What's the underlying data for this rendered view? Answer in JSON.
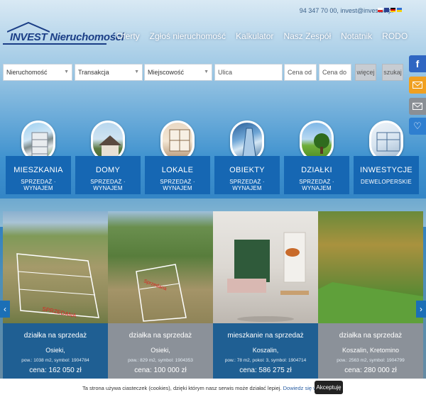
{
  "header": {
    "contact": "94 347 70 00, invest@investsc.pl",
    "logo_text": "INVEST Nieruchomości",
    "nav": [
      "Oferty",
      "Zgłoś nieruchomość",
      "Kalkulator",
      "Nasz Zespół",
      "Notatnik",
      "RODO"
    ]
  },
  "social": [
    {
      "icon": "facebook-icon",
      "color": "#2f66c2"
    },
    {
      "icon": "mail-icon",
      "color": "#f0a020"
    },
    {
      "icon": "envelope-icon",
      "color": "#8a8f95"
    },
    {
      "icon": "heart-icon",
      "color": "#2f7fd0"
    }
  ],
  "search": {
    "property": "Nieruchomość",
    "transaction": "Transakcja",
    "city": "Miejscowość",
    "street": "Ulica",
    "price_from": "Cena od",
    "price_to": "Cena do",
    "more": "więcej",
    "submit": "szukaj"
  },
  "categories": [
    {
      "title": "MIESZKANIA",
      "sub": "SPRZEDAŻ · WYNAJEM"
    },
    {
      "title": "DOMY",
      "sub": "SPRZEDAŻ · WYNAJEM"
    },
    {
      "title": "LOKALE",
      "sub": "SPRZEDAŻ · WYNAJEM"
    },
    {
      "title": "OBIEKTY",
      "sub": "SPRZEDAŻ · WYNAJEM"
    },
    {
      "title": "DZIAŁKI",
      "sub": "SPRZEDAŻ · WYNAJEM"
    },
    {
      "title": "INWESTYCJE",
      "sub": "DEWELOPERSKIE"
    }
  ],
  "listings": [
    {
      "type": "działka na sprzedaż",
      "location": "Osieki,",
      "details": "pow.: 1038 m2, symbol: 1904784",
      "price": "cena: 162 050 zł",
      "badge": "SPRZEDANA",
      "bg": "#1f5f93"
    },
    {
      "type": "działka na sprzedaż",
      "location": "Osieki,",
      "details": "pow.: 829 m2, symbol: 1904353",
      "price": "cena: 100 000 zł",
      "badge": "Sprzedana",
      "bg": "#8b9199"
    },
    {
      "type": "mieszkanie na sprzedaż",
      "location": "Koszalin,",
      "details": "pow.: 78 m2, pokoi: 3, symbol: 1904714",
      "price": "cena: 586 275 zł",
      "badge": "",
      "bg": "#1f5f93"
    },
    {
      "type": "działka na sprzedaż",
      "location": "Koszalin, Kretomino",
      "details": "pow.: 2563 m2, symbol: 1904799",
      "price": "cena: 280 000 zł",
      "badge": "",
      "bg": "#8b9199"
    }
  ],
  "cookie": {
    "text": "Ta strona używa ciasteczek (cookies), dzięki którym nasz serwis może działać lepiej.",
    "more": "Dowiedz się więcej",
    "accept": "Akceptuję"
  }
}
